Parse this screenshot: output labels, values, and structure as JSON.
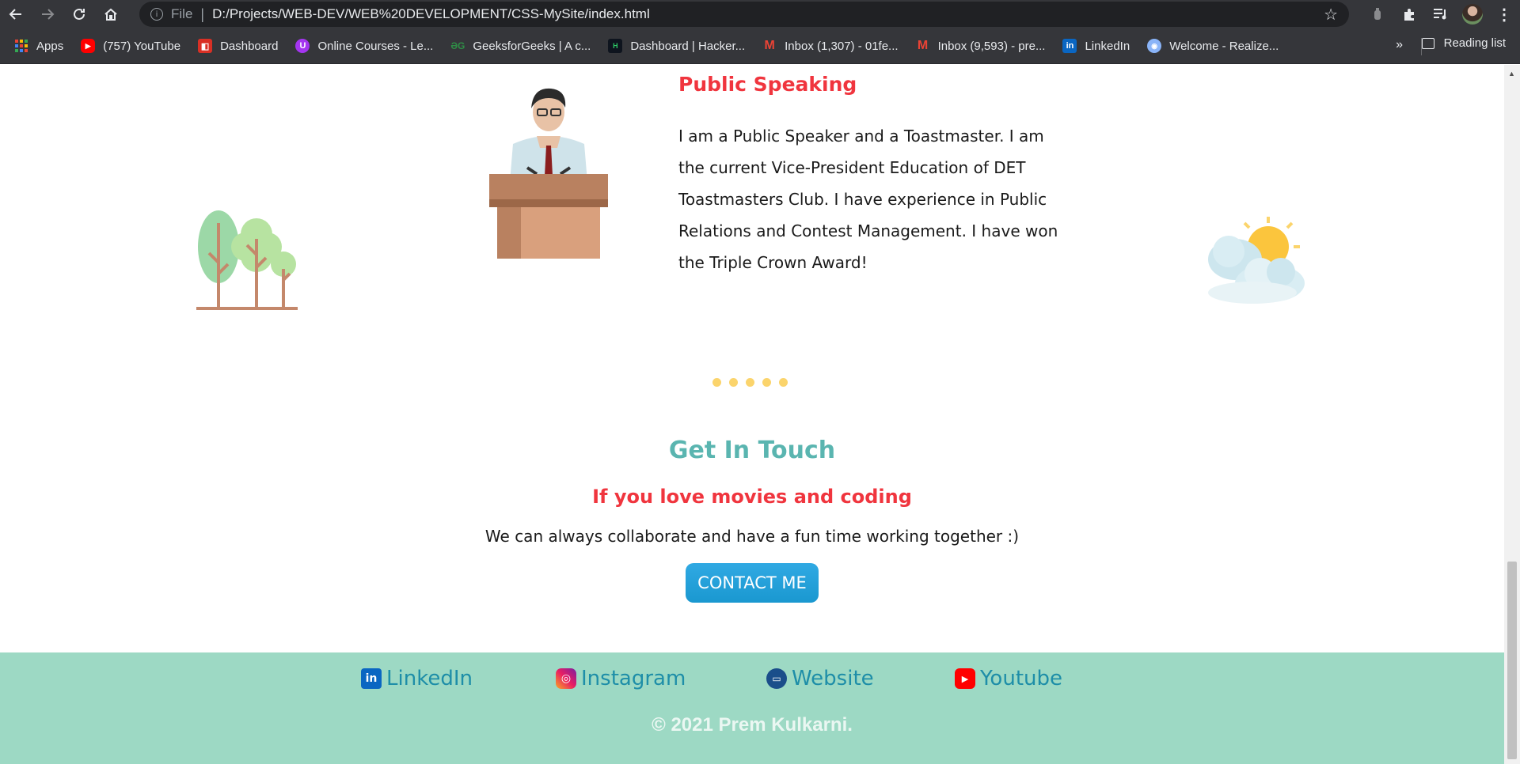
{
  "browser": {
    "url_scheme_label": "File",
    "url": "D:/Projects/WEB-DEV/WEB%20DEVELOPMENT/CSS-MySite/index.html",
    "bookmarks": [
      {
        "label": "Apps",
        "icon": "apps-grid-icon",
        "color": "#4285f4"
      },
      {
        "label": "(757) YouTube",
        "icon": "youtube-icon",
        "color": "#ff0000"
      },
      {
        "label": "Dashboard",
        "icon": "dashboard-icon",
        "color": "#d93025"
      },
      {
        "label": "Online Courses - Le...",
        "icon": "udemy-icon",
        "color": "#a435f0"
      },
      {
        "label": "GeeksforGeeks | A c...",
        "icon": "geeksforgeeks-icon",
        "color": "#2f8d46"
      },
      {
        "label": "Dashboard | Hacker...",
        "icon": "hackerrank-icon",
        "color": "#0e141e"
      },
      {
        "label": "Inbox (1,307) - 01fe...",
        "icon": "gmail-icon",
        "color": "#ea4335"
      },
      {
        "label": "Inbox (9,593) - pre...",
        "icon": "gmail-icon",
        "color": "#ea4335"
      },
      {
        "label": "LinkedIn",
        "icon": "linkedin-icon",
        "color": "#0a66c2"
      },
      {
        "label": "Welcome - Realize...",
        "icon": "realize-icon",
        "color": "#8ab4f8"
      }
    ],
    "more_label": "»",
    "reading_list_label": "Reading list"
  },
  "public_speaking": {
    "title": "Public Speaking",
    "text": "I am a Public Speaker and a Toastmaster. I am the current Vice-President Education of DET Toastmasters Club. I have experience in Public Relations and Contest Management. I have won the Triple Crown Award!"
  },
  "contact": {
    "title": "Get In Touch",
    "subtitle": "If you love movies and coding",
    "text": "We can always collaborate and have a fun time working together :)",
    "button_label": "CONTACT ME"
  },
  "footer": {
    "links": [
      {
        "label": "LinkedIn",
        "icon": "linkedin-icon"
      },
      {
        "label": "Instagram",
        "icon": "instagram-icon"
      },
      {
        "label": "Website",
        "icon": "website-icon"
      },
      {
        "label": "Youtube",
        "icon": "youtube-icon"
      }
    ],
    "copyright": "© 2021 Prem Kulkarni."
  },
  "colors": {
    "accent_red": "#f0353e",
    "accent_teal": "#5ab5b0",
    "footer_bg": "#9dd9c4",
    "button_blue": "#1a98d0",
    "dots_yellow": "#fbd46c"
  }
}
